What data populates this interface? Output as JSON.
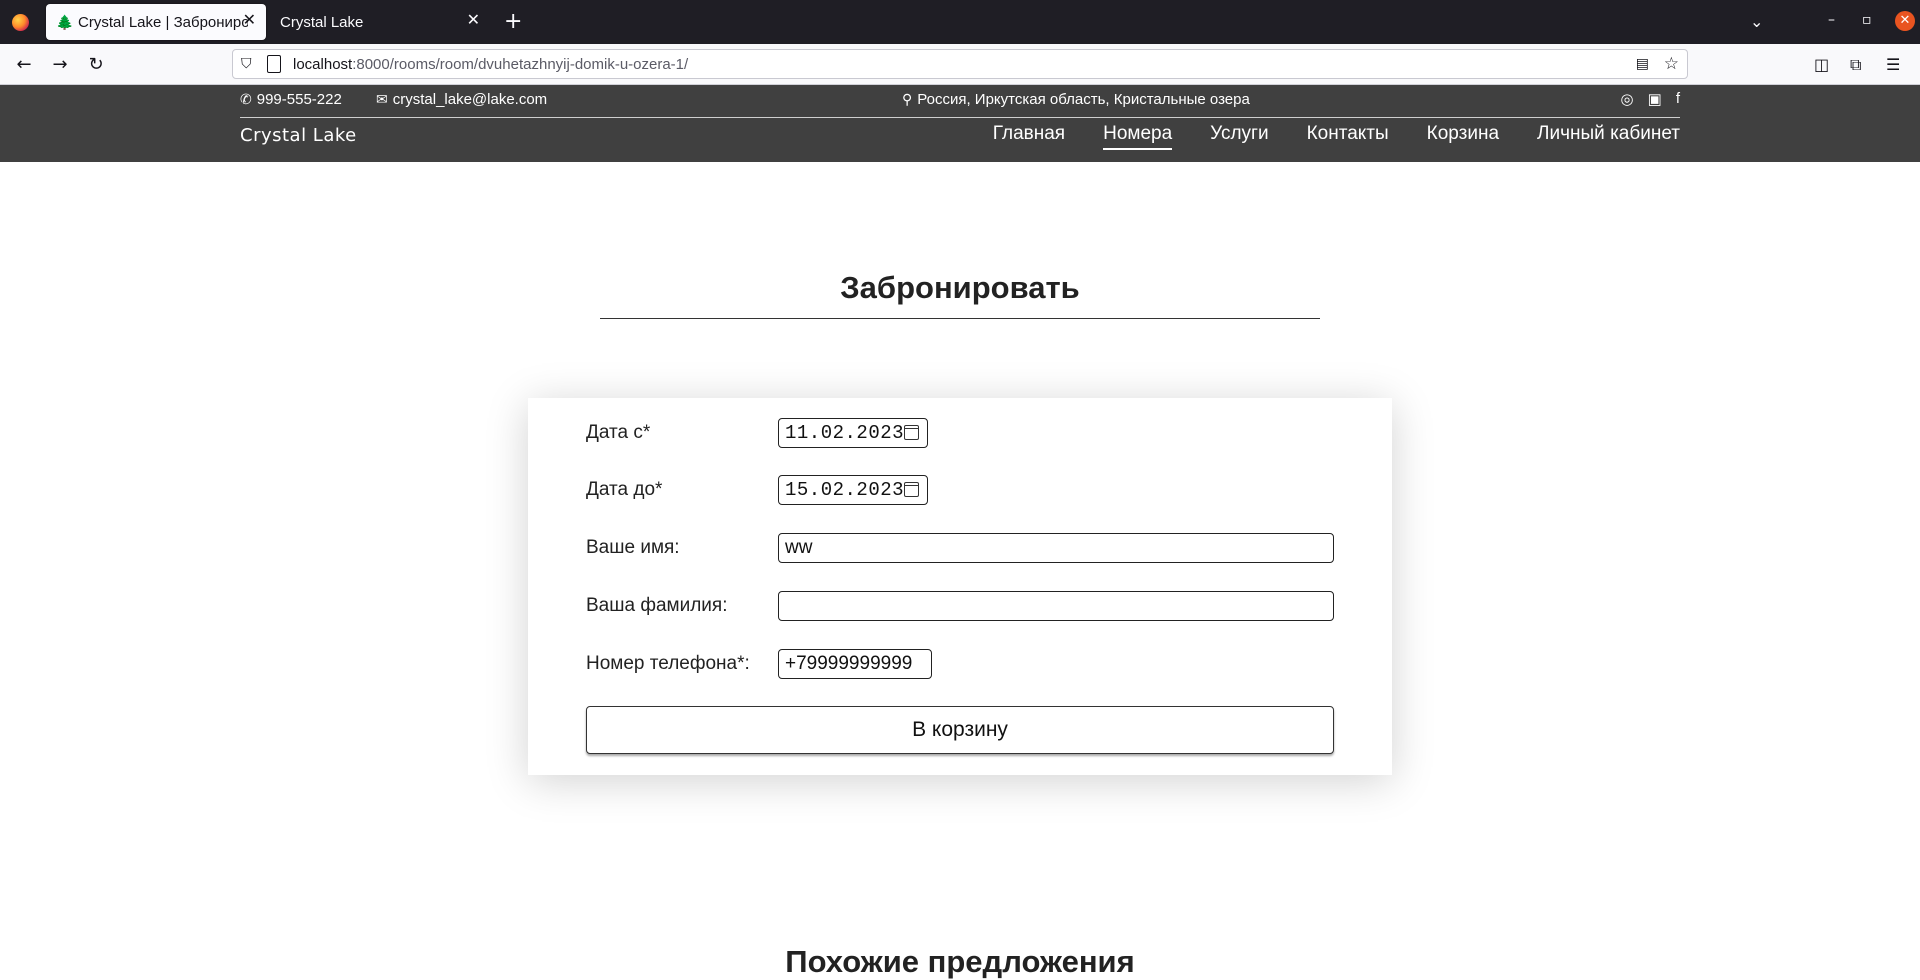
{
  "browser": {
    "tabs": [
      {
        "label": "Crystal Lake | Забронировать",
        "active": true
      },
      {
        "label": "Crystal Lake",
        "active": false
      }
    ],
    "url_host": "localhost",
    "url_path": ":8000/rooms/room/dvuhetazhnyij-domik-u-ozera-1/"
  },
  "header": {
    "phone": "999-555-222",
    "email": "crystal_lake@lake.com",
    "address": "Россия, Иркутская область, Кристальные озера",
    "brand": "Crystal Lake",
    "menu": [
      {
        "label": "Главная",
        "active": false
      },
      {
        "label": "Номера",
        "active": true
      },
      {
        "label": "Услуги",
        "active": false
      },
      {
        "label": "Контакты",
        "active": false
      },
      {
        "label": "Корзина",
        "active": false
      },
      {
        "label": "Личный кабинет",
        "active": false
      }
    ]
  },
  "booking": {
    "title": "Забронировать",
    "date_from_label": "Дата с*",
    "date_from_value": "11.02.2023",
    "date_to_label": "Дата до*",
    "date_to_value": "15.02.2023",
    "first_name_label": "Ваше имя:",
    "first_name_value": "ww",
    "last_name_label": "Ваша фамилия:",
    "last_name_value": "",
    "phone_label": "Номер телефона*:",
    "phone_value": "+79999999999",
    "submit_label": "В корзину"
  },
  "similar": {
    "title": "Похожие предложения"
  }
}
